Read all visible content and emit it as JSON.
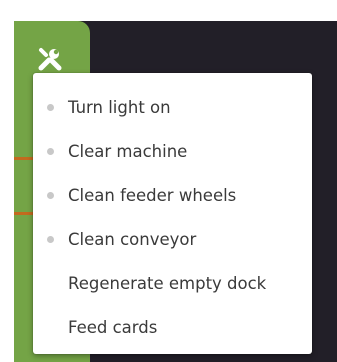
{
  "colors": {
    "panel_background": "#221f28",
    "accent_green": "#74a446",
    "accent_orange": "#c26a1e",
    "menu_text": "#3a3a3a",
    "bullet": "#c8c8c8"
  },
  "toolbar": {
    "tool_icon": "tools-icon"
  },
  "menu": {
    "items": [
      {
        "label": "Turn light on",
        "bullet": true
      },
      {
        "label": "Clear machine",
        "bullet": true
      },
      {
        "label": "Clean feeder wheels",
        "bullet": true
      },
      {
        "label": "Clean conveyor",
        "bullet": true
      },
      {
        "label": "Regenerate empty dock",
        "bullet": false
      },
      {
        "label": "Feed cards",
        "bullet": false
      }
    ]
  }
}
